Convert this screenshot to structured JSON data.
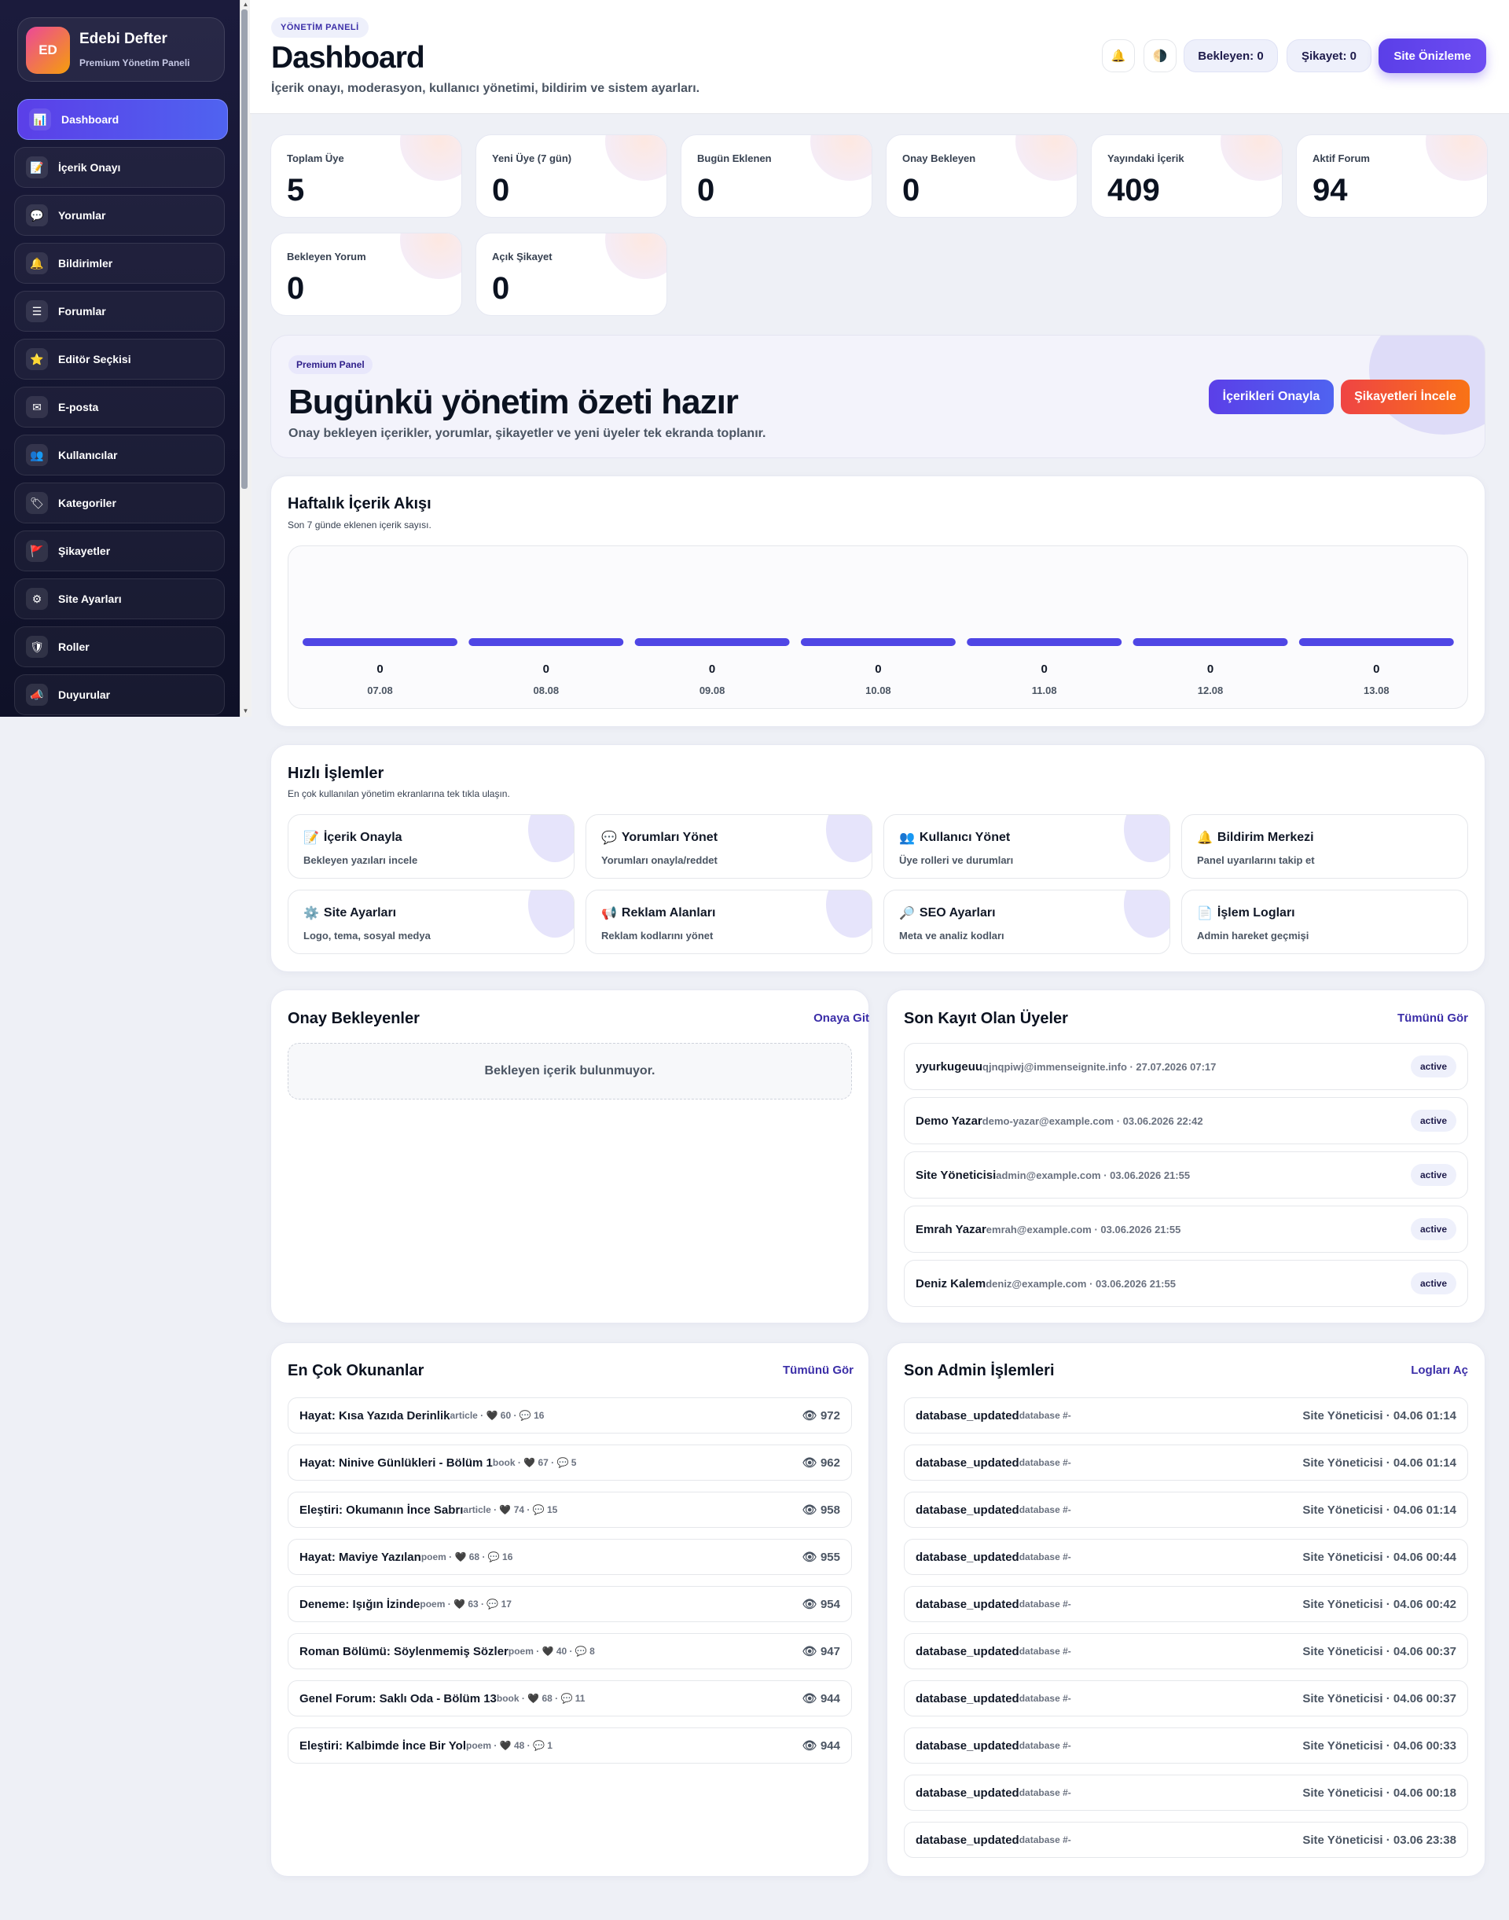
{
  "sidebar": {
    "brand": {
      "initials": "ED",
      "title": "Edebi Defter",
      "subtitle": "Premium Yönetim Paneli"
    },
    "items": [
      {
        "label": "Dashboard",
        "icon": "📊",
        "icon_name": "chart-icon",
        "active": true
      },
      {
        "label": "İçerik Onayı",
        "icon": "📝",
        "icon_name": "document-icon"
      },
      {
        "label": "Yorumlar",
        "icon": "💬",
        "icon_name": "comment-icon"
      },
      {
        "label": "Bildirimler",
        "icon": "🔔",
        "icon_name": "bell-icon"
      },
      {
        "label": "Forumlar",
        "icon": "☰",
        "icon_name": "list-icon"
      },
      {
        "label": "Editör Seçkisi",
        "icon": "⭐",
        "icon_name": "star-icon"
      },
      {
        "label": "E-posta",
        "icon": "✉",
        "icon_name": "mail-icon"
      },
      {
        "label": "Kullanıcılar",
        "icon": "👥",
        "icon_name": "users-icon"
      },
      {
        "label": "Kategoriler",
        "icon": "🏷",
        "icon_name": "tag-icon"
      },
      {
        "label": "Şikayetler",
        "icon": "🚩",
        "icon_name": "flag-icon"
      },
      {
        "label": "Site Ayarları",
        "icon": "⚙",
        "icon_name": "gear-icon"
      },
      {
        "label": "Roller",
        "icon": "🛡",
        "icon_name": "shield-icon"
      },
      {
        "label": "Duyurular",
        "icon": "📣",
        "icon_name": "megaphone-icon"
      }
    ]
  },
  "header": {
    "tag": "YÖNETİM PANELİ",
    "title": "Dashboard",
    "subtitle": "İçerik onayı, moderasyon, kullanıcı yönetimi, bildirim ve sistem ayarları.",
    "bell_icon": "🔔",
    "theme_icon": "🌗",
    "pending_label": "Bekleyen: 0",
    "complaint_label": "Şikayet: 0",
    "preview_label": "Site Önizleme"
  },
  "stats": [
    {
      "label": "Toplam Üye",
      "value": "5"
    },
    {
      "label": "Yeni Üye (7 gün)",
      "value": "0"
    },
    {
      "label": "Bugün Eklenen",
      "value": "0"
    },
    {
      "label": "Onay Bekleyen",
      "value": "0"
    },
    {
      "label": "Yayındaki İçerik",
      "value": "409"
    },
    {
      "label": "Aktif Forum",
      "value": "94"
    },
    {
      "label": "Bekleyen Yorum",
      "value": "0"
    },
    {
      "label": "Açık Şikayet",
      "value": "0"
    }
  ],
  "banner": {
    "tag": "Premium Panel",
    "title": "Bugünkü yönetim özeti hazır",
    "subtitle": "Onay bekleyen içerikler, yorumlar, şikayetler ve yeni üyeler tek ekranda toplanır.",
    "approve_label": "İçerikleri Onayla",
    "complaints_label": "Şikayetleri İncele"
  },
  "weekly": {
    "title": "Haftalık İçerik Akışı",
    "subtitle": "Son 7 günde eklenen içerik sayısı."
  },
  "chart_data": {
    "type": "bar",
    "categories": [
      "07.08",
      "08.08",
      "09.08",
      "10.08",
      "11.08",
      "12.08",
      "13.08"
    ],
    "values": [
      0,
      0,
      0,
      0,
      0,
      0,
      0
    ],
    "title": "Haftalık İçerik Akışı",
    "xlabel": "",
    "ylabel": "",
    "bar_color": "#4f46e5"
  },
  "quick": {
    "title": "Hızlı İşlemler",
    "subtitle": "En çok kullanılan yönetim ekranlarına tek tıkla ulaşın.",
    "items": [
      {
        "icon": "📝",
        "title": "İçerik Onayla",
        "sub": "Bekleyen yazıları incele"
      },
      {
        "icon": "💬",
        "title": "Yorumları Yönet",
        "sub": "Yorumları onayla/reddet"
      },
      {
        "icon": "👥",
        "title": "Kullanıcı Yönet",
        "sub": "Üye rolleri ve durumları"
      },
      {
        "icon": "🔔",
        "title": "Bildirim Merkezi",
        "sub": "Panel uyarılarını takip et"
      },
      {
        "icon": "⚙️",
        "title": "Site Ayarları",
        "sub": "Logo, tema, sosyal medya"
      },
      {
        "icon": "📢",
        "title": "Reklam Alanları",
        "sub": "Reklam kodlarını yönet"
      },
      {
        "icon": "🔎",
        "title": "SEO Ayarları",
        "sub": "Meta ve analiz kodları"
      },
      {
        "icon": "📄",
        "title": "İşlem Logları",
        "sub": "Admin hareket geçmişi"
      }
    ]
  },
  "pending": {
    "title": "Onay Bekleyenler",
    "link": "Onaya Git",
    "empty": "Bekleyen içerik bulunmuyor."
  },
  "members": {
    "title": "Son Kayıt Olan Üyeler",
    "link": "Tümünü Gör",
    "rows": [
      {
        "name": "yyurkugeuu",
        "meta": "qjnqpiwj@immenseignite.info · 27.07.2026 07:17",
        "status": "active"
      },
      {
        "name": "Demo Yazar",
        "meta": "demo-yazar@example.com · 03.06.2026 22:42",
        "status": "active"
      },
      {
        "name": "Site Yöneticisi",
        "meta": "admin@example.com · 03.06.2026 21:55",
        "status": "active"
      },
      {
        "name": "Emrah Yazar",
        "meta": "emrah@example.com · 03.06.2026 21:55",
        "status": "active"
      },
      {
        "name": "Deniz Kalem",
        "meta": "deniz@example.com · 03.06.2026 21:55",
        "status": "active"
      }
    ]
  },
  "popular": {
    "title": "En Çok Okunanlar",
    "link": "Tümünü Gör",
    "rows": [
      {
        "title": "Hayat: Kısa Yazıda Derinlik",
        "meta": "article · 🖤 60 · 💬 16",
        "views": "👁 972"
      },
      {
        "title": "Hayat: Ninive Günlükleri - Bölüm 1",
        "meta": "book · 🖤 67 · 💬 5",
        "views": "👁 962"
      },
      {
        "title": "Eleştiri: Okumanın İnce Sabrı",
        "meta": "article · 🖤 74 · 💬 15",
        "views": "👁 958"
      },
      {
        "title": "Hayat: Maviye Yazılan",
        "meta": "poem · 🖤 68 · 💬 16",
        "views": "👁 955"
      },
      {
        "title": "Deneme: Işığın İzinde",
        "meta": "poem · 🖤 63 · 💬 17",
        "views": "👁 954"
      },
      {
        "title": "Roman Bölümü: Söylenmemiş Sözler",
        "meta": "poem · 🖤 40 · 💬 8",
        "views": "👁 947"
      },
      {
        "title": "Genel Forum: Saklı Oda - Bölüm 13",
        "meta": "book · 🖤 68 · 💬 11",
        "views": "👁 944"
      },
      {
        "title": "Eleştiri: Kalbimde İnce Bir Yol",
        "meta": "poem · 🖤 48 · 💬 1",
        "views": "👁 944"
      }
    ]
  },
  "logs": {
    "title": "Son Admin İşlemleri",
    "link": "Logları Aç",
    "rows": [
      {
        "action": "database_updated",
        "meta": "database #-",
        "who": "Site Yöneticisi · 04.06 01:14"
      },
      {
        "action": "database_updated",
        "meta": "database #-",
        "who": "Site Yöneticisi · 04.06 01:14"
      },
      {
        "action": "database_updated",
        "meta": "database #-",
        "who": "Site Yöneticisi · 04.06 01:14"
      },
      {
        "action": "database_updated",
        "meta": "database #-",
        "who": "Site Yöneticisi · 04.06 00:44"
      },
      {
        "action": "database_updated",
        "meta": "database #-",
        "who": "Site Yöneticisi · 04.06 00:42"
      },
      {
        "action": "database_updated",
        "meta": "database #-",
        "who": "Site Yöneticisi · 04.06 00:37"
      },
      {
        "action": "database_updated",
        "meta": "database #-",
        "who": "Site Yöneticisi · 04.06 00:37"
      },
      {
        "action": "database_updated",
        "meta": "database #-",
        "who": "Site Yöneticisi · 04.06 00:33"
      },
      {
        "action": "database_updated",
        "meta": "database #-",
        "who": "Site Yöneticisi · 04.06 00:18"
      },
      {
        "action": "database_updated",
        "meta": "database #-",
        "who": "Site Yöneticisi · 03.06 23:38"
      }
    ]
  }
}
